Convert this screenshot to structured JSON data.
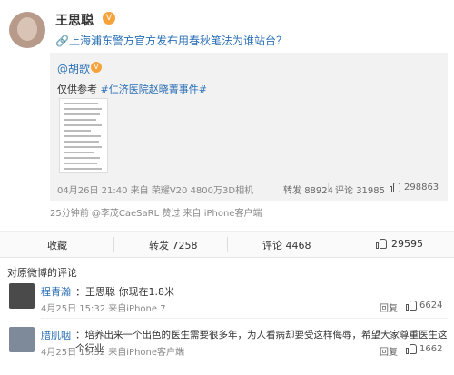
{
  "post": {
    "author": "王思聪",
    "verified_badge": "V",
    "text_link": "上海浦东警方官方发布用春秋笔法为谁站台？",
    "quoted": {
      "author": "@胡歌",
      "verified_badge": "V",
      "text_prefix": "仅供参考",
      "hashtag": "#仁济医院赵晓菁事件#",
      "timestamp": "04月26日 21:40",
      "source": "来自 荣耀V20 4800万3D相机",
      "reposts_label": "转发",
      "reposts": "88924",
      "comments_label": "评论",
      "comments": "31985",
      "likes": "298863"
    },
    "meta": "25分钟前 @李茂CaeSaRL 赞过 来自 iPhone客户端"
  },
  "actions": {
    "favorite_label": "收藏",
    "repost_label": "转发",
    "repost_count": "7258",
    "comment_label": "评论",
    "comment_count": "4468",
    "like_count": "29595"
  },
  "comments_header": "对原微博的评论",
  "comments": [
    {
      "name": "程青瀚",
      "text": "：王思聪 你现在1.8米",
      "time": "4月25日 15:32 来自iPhone 7",
      "reply_label": "回复",
      "likes": "6624",
      "avatar_color": "#4a4a4a"
    },
    {
      "name": "腊肌咽",
      "text": "：培养出来一个出色的医生需要很多年，为人看病却要受这样侮辱，希望大家尊重医生这个行业",
      "time": "4月25日 15:32 来自iPhone客户端",
      "reply_label": "回复",
      "likes": "1662",
      "avatar_color": "#7e8a9a"
    }
  ],
  "colors": {
    "link": "#2a6fb5",
    "verified": "#f7a33c"
  }
}
